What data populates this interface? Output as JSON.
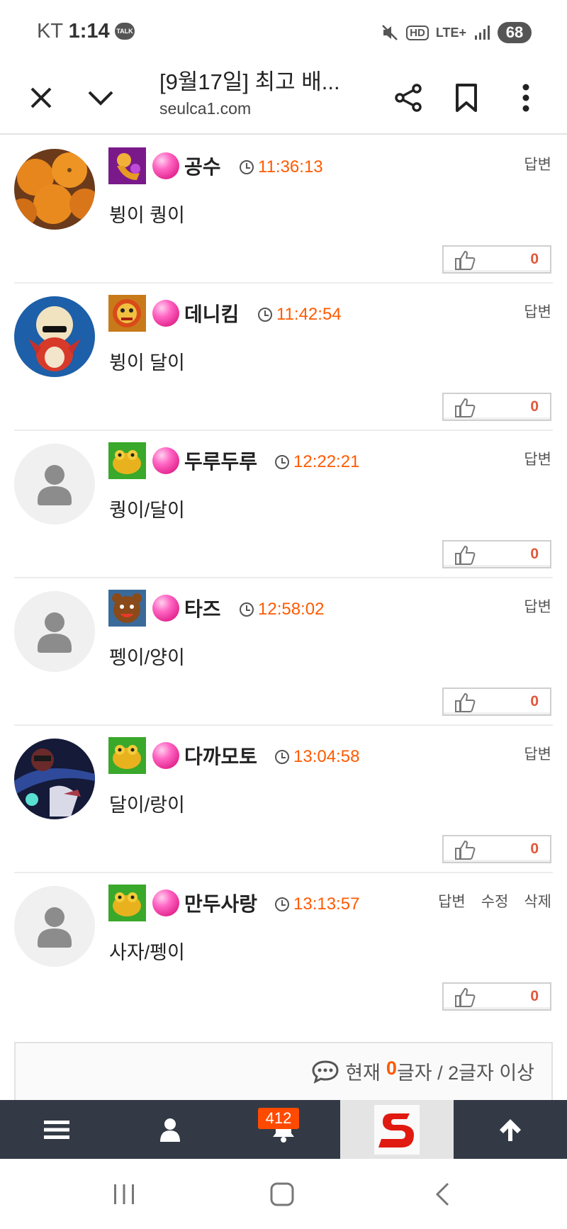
{
  "status_bar": {
    "carrier": "KT",
    "time": "1:14",
    "talk_badge": "TALK",
    "hd": "HD",
    "network": "LTE+",
    "battery": "68"
  },
  "browser": {
    "title": "[9월17일] 최고 배...",
    "domain": "seulca1.com"
  },
  "comments": [
    {
      "author": "공수",
      "time": "11:36:13",
      "text": "뷩이 퀑이",
      "likes": "0",
      "actions": [
        "답변"
      ],
      "avatar": "tangerines",
      "level": "purple-dragon"
    },
    {
      "author": "데니킴",
      "time": "11:42:54",
      "text": "뷩이 달이",
      "likes": "0",
      "actions": [
        "답변"
      ],
      "avatar": "bird",
      "level": "gold-lion"
    },
    {
      "author": "두루두루",
      "time": "12:22:21",
      "text": "퀑이/달이",
      "likes": "0",
      "actions": [
        "답변"
      ],
      "avatar": "default",
      "level": "green-frog"
    },
    {
      "author": "타즈",
      "time": "12:58:02",
      "text": "펭이/양이",
      "likes": "0",
      "actions": [
        "답변"
      ],
      "avatar": "default",
      "level": "blue-bear"
    },
    {
      "author": "다까모토",
      "time": "13:04:58",
      "text": "달이/랑이",
      "likes": "0",
      "actions": [
        "답변"
      ],
      "avatar": "anime",
      "level": "green-frog"
    },
    {
      "author": "만두사랑",
      "time": "13:13:57",
      "text": "사자/펭이",
      "likes": "0",
      "actions": [
        "답변",
        "수정",
        "삭제"
      ],
      "avatar": "default",
      "level": "green-frog"
    }
  ],
  "comment_input": {
    "prefix": "현재",
    "count": "0",
    "suffix": "글자 / 2글자 이상"
  },
  "toolbar": {
    "notifications": "412",
    "items": [
      "menu-icon",
      "user-icon",
      "bell-icon",
      "site-logo",
      "arrow-up-icon"
    ]
  },
  "colors": {
    "accent": "#ff5a00",
    "toolbar_bg": "#333a45",
    "like_count": "#e0573a"
  }
}
